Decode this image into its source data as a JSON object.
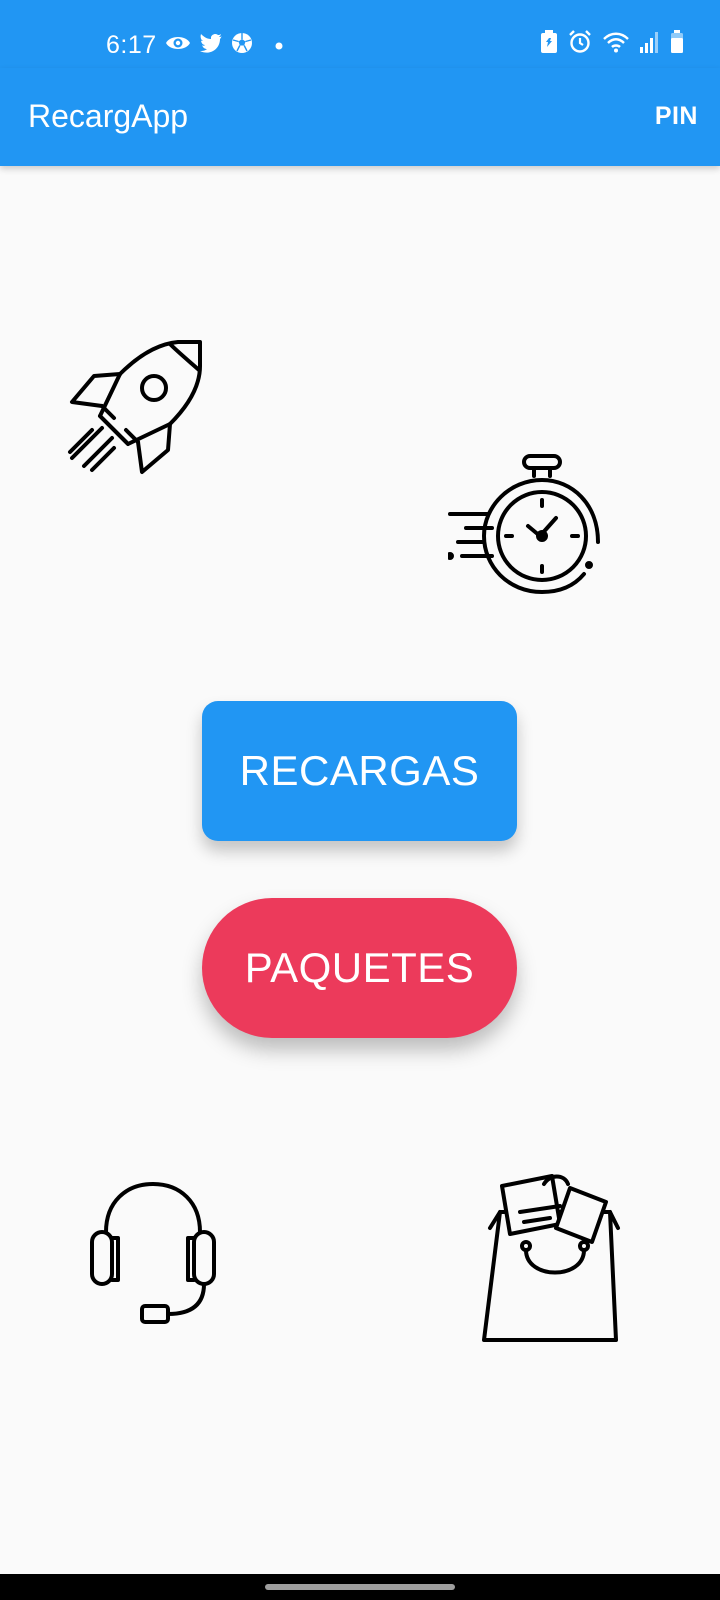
{
  "status_bar": {
    "time": "6:17",
    "left_icons": [
      "eye-icon",
      "twitter-icon",
      "soccer-ball-icon",
      "dot-icon"
    ],
    "right_icons": [
      "battery-saver-icon",
      "alarm-icon",
      "wifi-icon",
      "signal-icon",
      "battery-icon"
    ]
  },
  "app_bar": {
    "title": "RecargApp",
    "action_label": "PIN"
  },
  "main": {
    "decorations": [
      "rocket-icon",
      "stopwatch-icon",
      "headset-icon",
      "shopping-bag-icon"
    ],
    "recargas_label": "RECARGAS",
    "paquetes_label": "PAQUETES"
  },
  "colors": {
    "primary": "#2196F3",
    "accent": "#EC3A5B",
    "background": "#FAFAFA"
  }
}
